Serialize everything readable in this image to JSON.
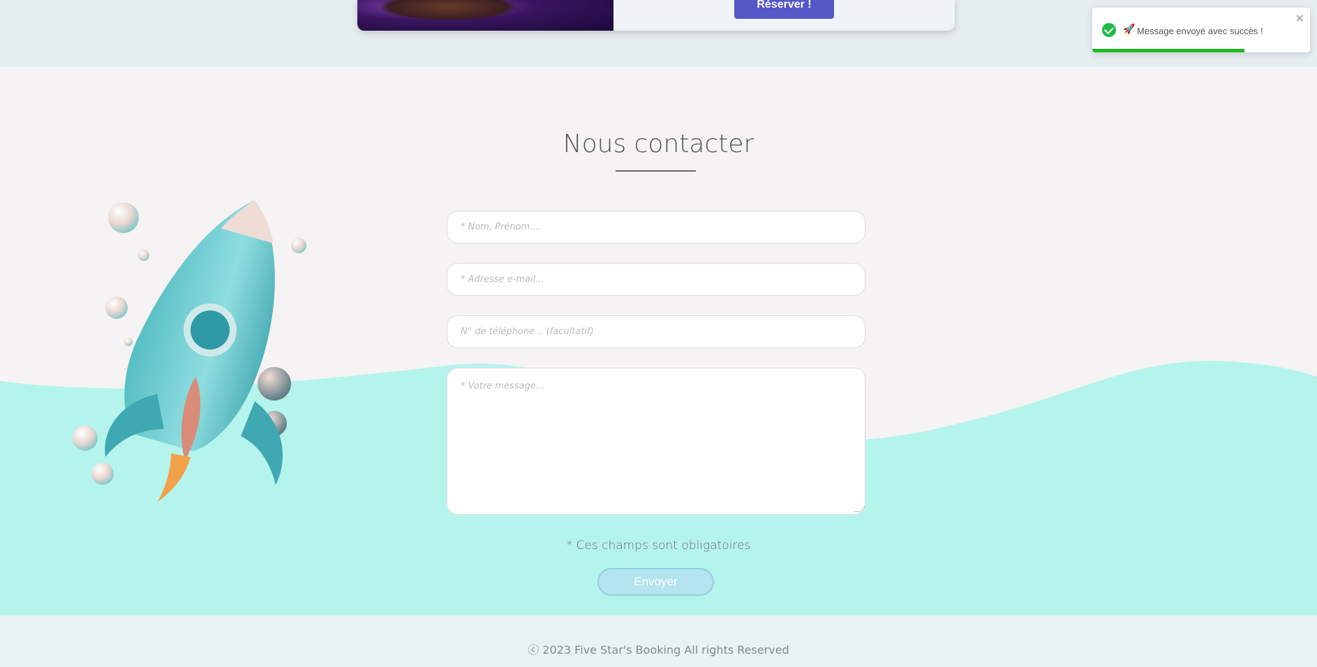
{
  "card": {
    "reserve_label": "Réserver !"
  },
  "toast": {
    "icon": "check-circle-icon",
    "emoji": "🚀",
    "text": "Message envoyé avec succès !",
    "close": "✕",
    "progress": 0.7,
    "color": "#1fb81f"
  },
  "contact": {
    "title": "Nous contacter",
    "name_placeholder": "* Nom, Prénom....",
    "email_placeholder": "* Adresse e-mail...",
    "phone_placeholder": "N° de téléphone... (facultatif)",
    "message_placeholder": "* Votre message...",
    "required_note": "* Ces champs sont obligatoires",
    "send_label": "Envoyer"
  },
  "footer": {
    "text": "ⓒ 2023 Five Star's Booking All rights Reserved"
  },
  "colors": {
    "wave": "#b5f4ec",
    "accent_button": "#5557c6",
    "send_button": "#b4e4ef"
  }
}
